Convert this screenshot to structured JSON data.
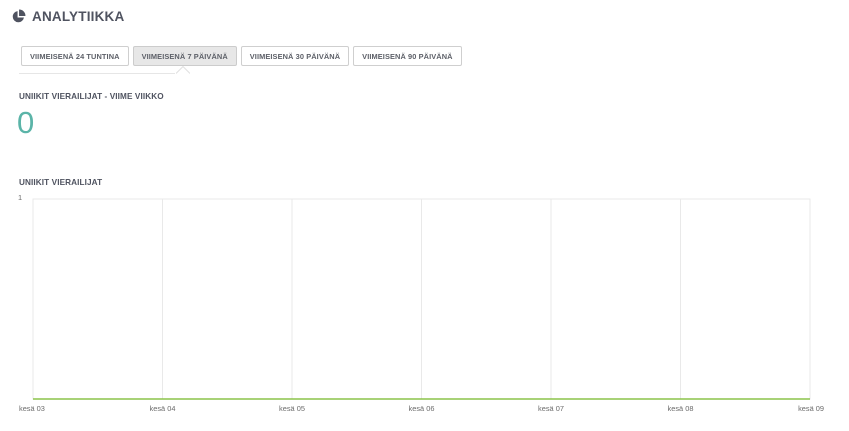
{
  "header": {
    "title": "ANALYTIIKKA",
    "icon": "pie-chart-icon"
  },
  "tabs": [
    {
      "label": "VIIMEISENÄ 24 TUNTINA",
      "active": false
    },
    {
      "label": "VIIMEISENÄ 7 PÄIVÄNÄ",
      "active": true
    },
    {
      "label": "VIIMEISENÄ 30 PÄIVÄNÄ",
      "active": false
    },
    {
      "label": "VIIMEISENÄ 90 PÄIVÄNÄ",
      "active": false
    }
  ],
  "summary": {
    "label": "UNIIKIT VIERAILIJAT - VIIME VIIKKO",
    "value": "0"
  },
  "chart_title": "UNIIKIT VIERAILIJAT",
  "colors": {
    "accent": "#5bb4a8",
    "line": "#8bc34a",
    "grid": "#e9e9e9"
  },
  "chart_data": {
    "type": "line",
    "title": "UNIIKIT VIERAILIJAT",
    "xlabel": "",
    "ylabel": "",
    "categories": [
      "kesä 03",
      "kesä 04",
      "kesä 05",
      "kesä 06",
      "kesä 07",
      "kesä 08",
      "kesä 09"
    ],
    "series": [
      {
        "values": [
          0,
          0,
          0,
          0,
          0,
          0,
          0
        ]
      }
    ],
    "ylim": [
      0,
      1
    ],
    "yticks": [
      "1"
    ],
    "grid": true
  }
}
